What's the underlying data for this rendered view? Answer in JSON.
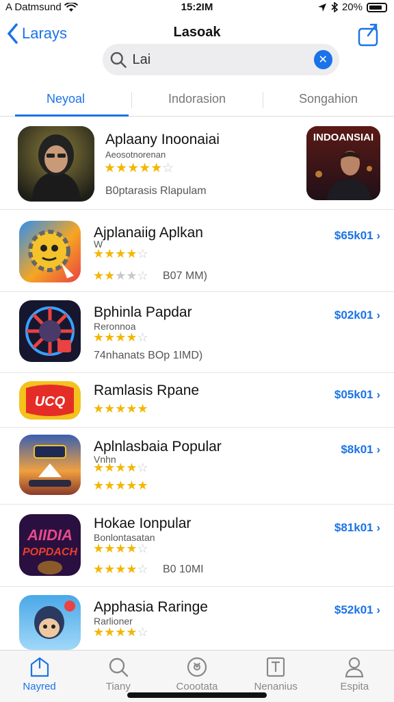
{
  "status": {
    "carrier": "A Datmsund",
    "time": "15:2IM",
    "battery": "20%"
  },
  "nav": {
    "back_label": "Larays",
    "title": "Lasoak"
  },
  "search": {
    "value": "Lai"
  },
  "tabs": [
    {
      "label": "Neyoal",
      "active": true
    },
    {
      "label": "Indorasion",
      "active": false
    },
    {
      "label": "Songahion",
      "active": false
    }
  ],
  "featured": {
    "title": "Aplaany Inoonaiai",
    "subtitle": "Aeosotnorenan",
    "rating": 4.5,
    "meta": "B0ptarasis  Rlapulam",
    "thumb_caption": "INDOANSIAI"
  },
  "apps": [
    {
      "name": "Ajplanaiig Aplkan",
      "subtitle": "W",
      "rating": 4,
      "rating2": 2.5,
      "meta": "B07 MM)",
      "price": "$65k01"
    },
    {
      "name": "Bphinla Papdar",
      "subtitle": "Reronnoa",
      "rating": 4,
      "meta": "74nhanats  BOp 1IMD)",
      "price": "$02k01"
    },
    {
      "name": "Ramlasis Rpane",
      "subtitle": "",
      "rating": 5,
      "meta": "",
      "price": "$05k01"
    },
    {
      "name": "Aplnlasbaia Popular",
      "subtitle": "Vnhn",
      "rating": 4,
      "rating2": 5,
      "meta": "",
      "price": "$8k01"
    },
    {
      "name": "Hokae Ionpular",
      "subtitle": "Bonlontasatan",
      "rating": 4,
      "rating2": 4,
      "meta": "B0 10MI",
      "price": "$81k01"
    },
    {
      "name": "Apphasia Raringe",
      "subtitle": "Rarlioner",
      "rating": 4,
      "meta": "",
      "price": "$52k01"
    }
  ],
  "tabbar": [
    {
      "label": "Nayred",
      "icon": "today-icon",
      "active": true
    },
    {
      "label": "Tiany",
      "icon": "search-icon",
      "active": false
    },
    {
      "label": "Coootata",
      "icon": "apps-icon",
      "active": false
    },
    {
      "label": "Nenanius",
      "icon": "arcade-icon",
      "active": false
    },
    {
      "label": "Espita",
      "icon": "account-icon",
      "active": false
    }
  ],
  "colors": {
    "accent": "#1a73e8",
    "star": "#f2b705"
  }
}
